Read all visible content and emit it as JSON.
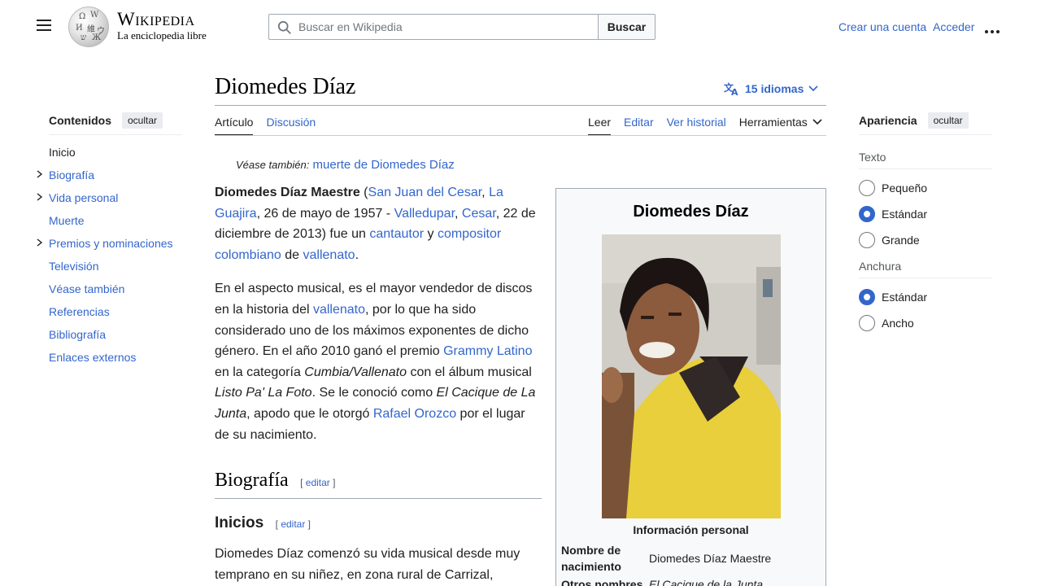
{
  "header": {
    "logo_wordmark": "Wikipedia",
    "logo_tagline": "La enciclopedia libre",
    "search_placeholder": "Buscar en Wikipedia",
    "search_button": "Buscar",
    "create_account": "Crear una cuenta",
    "login": "Acceder"
  },
  "toc": {
    "title": "Contenidos",
    "hide_label": "ocultar",
    "items": [
      {
        "label": "Inicio",
        "expandable": false
      },
      {
        "label": "Biografía",
        "expandable": true
      },
      {
        "label": "Vida personal",
        "expandable": true
      },
      {
        "label": "Muerte",
        "expandable": false
      },
      {
        "label": "Premios y nominaciones",
        "expandable": true
      },
      {
        "label": "Televisión",
        "expandable": false
      },
      {
        "label": "Véase también",
        "expandable": false
      },
      {
        "label": "Referencias",
        "expandable": false
      },
      {
        "label": "Bibliografía",
        "expandable": false
      },
      {
        "label": "Enlaces externos",
        "expandable": false
      }
    ]
  },
  "page": {
    "title": "Diomedes Díaz",
    "languages": "15 idiomas",
    "tabs_left": [
      "Artículo",
      "Discusión"
    ],
    "tabs_right": [
      "Leer",
      "Editar",
      "Ver historial"
    ],
    "tools": "Herramientas",
    "hatnote_prefix": "Véase también:",
    "hatnote_link": "muerte de Diomedes Díaz"
  },
  "article": {
    "p1": {
      "bold": "Diomedes Díaz Maestre",
      "t1": " (",
      "l1": "San Juan del Cesar",
      "t2": ", ",
      "l2": "La Guajira",
      "t3": ", 26 de mayo de 1957 - ",
      "l3": "Valledupar",
      "t4": ", ",
      "l4": "Cesar",
      "t5": ", 22 de diciembre de 2013) fue un ",
      "l5": "cantautor",
      "t6": " y ",
      "l6": "compositor colombiano",
      "t7": " de ",
      "l7": "vallenato",
      "t8": "."
    },
    "p2": {
      "t1": "En el aspecto musical, es el mayor vendedor de discos en la historia del ",
      "l1": "vallenato",
      "t2": ", por lo que ha sido considerado uno de los máximos exponentes de dicho género. En el año 2010 ganó el premio ",
      "l2": "Grammy Latino",
      "t3": " en la categoría ",
      "i1": "Cumbia/Vallenato",
      "t4": " con el álbum musical ",
      "i2": "Listo Pa' La Foto",
      "t5": ". Se le conoció como ",
      "i3": "El Cacique de La Junta",
      "t6": ", apodo que le otorgó ",
      "l3": "Rafael Orozco",
      "t7": " por el lugar de su nacimiento."
    },
    "h2": "Biografía",
    "h3": "Inicios",
    "edit_label": "editar",
    "p3": "Diomedes Díaz comenzó su vida musical desde muy temprano en su niñez, en zona rural de Carrizal,"
  },
  "infobox": {
    "title": "Diomedes Díaz",
    "section": "Información personal",
    "birth_name_label": "Nombre de nacimiento",
    "birth_name_value": "Diomedes Díaz Maestre",
    "other_names_label": "Otros nombres",
    "other_names_value": "El Cacique de la Junta"
  },
  "appearance": {
    "title": "Apariencia",
    "hide_label": "ocultar",
    "text_label": "Texto",
    "text_options": [
      {
        "label": "Pequeño",
        "checked": false
      },
      {
        "label": "Estándar",
        "checked": true
      },
      {
        "label": "Grande",
        "checked": false
      }
    ],
    "width_label": "Anchura",
    "width_options": [
      {
        "label": "Estándar",
        "checked": true
      },
      {
        "label": "Ancho",
        "checked": false
      }
    ]
  }
}
